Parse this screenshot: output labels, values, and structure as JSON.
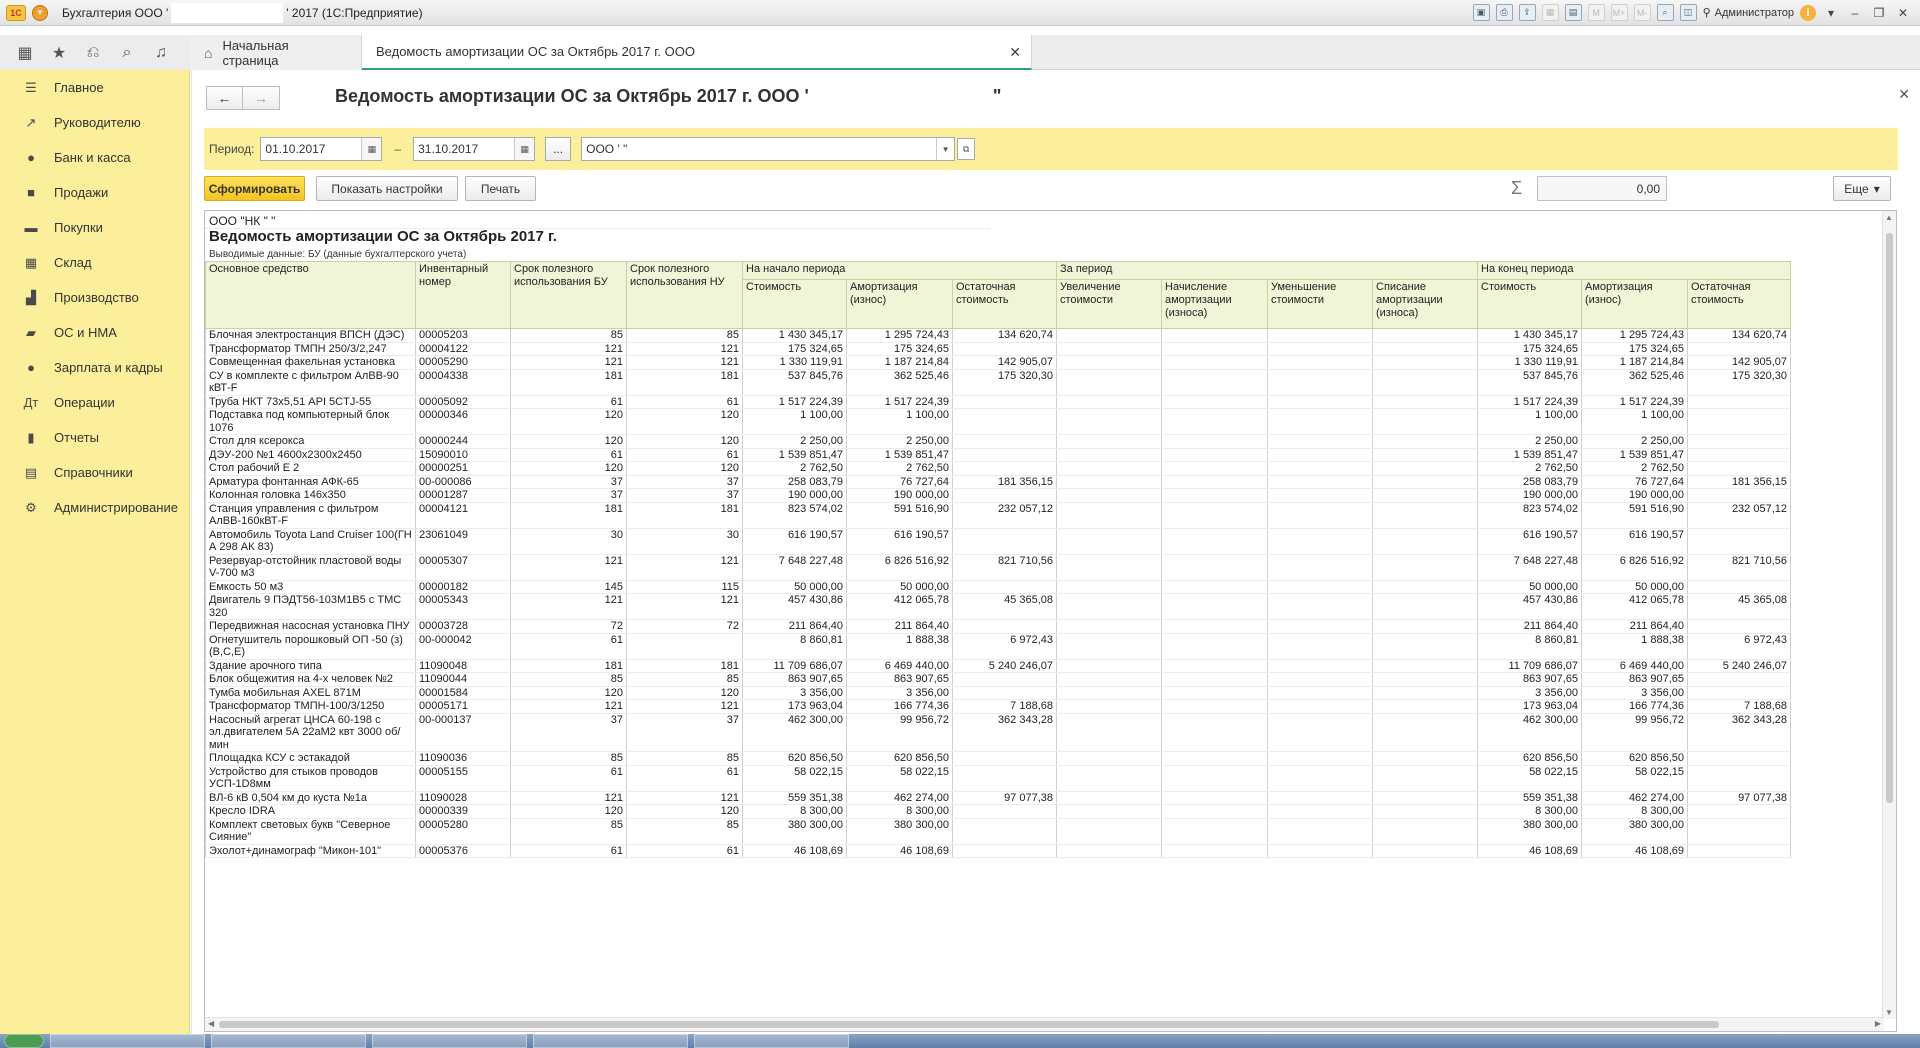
{
  "window": {
    "title_prefix": "Бухгалтерия ООО '",
    "title_suffix": "' 2017  (1С:Предприятие)",
    "user": "Администратор",
    "toolbar_icons": [
      "save-icon",
      "print-icon",
      "upload-icon",
      "calendar-icon",
      "calendar-grid-icon",
      "memory-m-icon",
      "memory-m-plus-icon",
      "memory-m-minus-icon",
      "zoom-icon",
      "panel-icon"
    ],
    "memory_labels": [
      "M",
      "M+",
      "M-"
    ]
  },
  "tabs": {
    "home": "Начальная страница",
    "active": "Ведомость амортизации ОС за Октябрь 2017 г. ООО"
  },
  "sidebar": {
    "items": [
      {
        "label": "Главное",
        "icon": "menu-icon",
        "glyph": "☰"
      },
      {
        "label": "Руководителю",
        "icon": "trend-icon",
        "glyph": "↗"
      },
      {
        "label": "Банк и касса",
        "icon": "coin-icon",
        "glyph": "●"
      },
      {
        "label": "Продажи",
        "icon": "bag-icon",
        "glyph": "■"
      },
      {
        "label": "Покупки",
        "icon": "cart-icon",
        "glyph": "▬"
      },
      {
        "label": "Склад",
        "icon": "warehouse-icon",
        "glyph": "▦"
      },
      {
        "label": "Производство",
        "icon": "factory-icon",
        "glyph": "▟"
      },
      {
        "label": "ОС и НМА",
        "icon": "truck-icon",
        "glyph": "▰"
      },
      {
        "label": "Зарплата и кадры",
        "icon": "person-icon",
        "glyph": "●"
      },
      {
        "label": "Операции",
        "icon": "operations-icon",
        "glyph": "Дт"
      },
      {
        "label": "Отчеты",
        "icon": "bar-chart-icon",
        "glyph": "▮"
      },
      {
        "label": "Справочники",
        "icon": "book-icon",
        "glyph": "▤"
      },
      {
        "label": "Администрирование",
        "icon": "gear-icon",
        "glyph": "⚙"
      }
    ]
  },
  "form": {
    "title_prefix": "Ведомость амортизации ОС за Октябрь 2017 г. ООО '",
    "title_suffix": "\"",
    "period_label": "Период:",
    "date_from": "01.10.2017",
    "date_to": "31.10.2017",
    "dots": "...",
    "organization": "ООО '                              \"",
    "buttons": {
      "generate": "Сформировать",
      "settings": "Показать настройки",
      "print": "Печать",
      "more": "Еще"
    },
    "sum_value": "0,00"
  },
  "report": {
    "org_line": "ООО \"НК \"                              \"",
    "title": "Ведомость амортизации ОС за Октябрь 2017 г.",
    "subtitle": "Выводимые данные:  БУ (данные бухгалтерского учета)",
    "header_groups": {
      "asset": "Основное средство",
      "inv": "Инвентарный номер",
      "term_bu": "Срок полезного использования БУ",
      "term_nu": "Срок полезного использования НУ",
      "start": "На начало периода",
      "period": "За период",
      "end": "На конец периода"
    },
    "sub_headers": {
      "start": [
        "Стоимость",
        "Амортизация (износ)",
        "Остаточная стоимость"
      ],
      "period": [
        "Увеличение стоимости",
        "Начисление амортизации (износа)",
        "Уменьшение стоимости",
        "Списание амортизации (износа)"
      ],
      "end": [
        "Стоимость",
        "Амортизация (износ)",
        "Остаточная стоимость"
      ]
    },
    "rows": [
      [
        "Блочная электростанция ВПСН (ДЭС)",
        "00005203",
        "85",
        "85",
        "1 430 345,17",
        "1 295 724,43",
        "134 620,74",
        "",
        "",
        "",
        "",
        "1 430 345,17",
        "1 295 724,43",
        "134 620,74"
      ],
      [
        "Трансформатор ТМПН 250/3/2,247",
        "00004122",
        "121",
        "121",
        "175 324,65",
        "175 324,65",
        "",
        "",
        "",
        "",
        "",
        "175 324,65",
        "175 324,65",
        ""
      ],
      [
        "Совмещенная факельная установка",
        "00005290",
        "121",
        "121",
        "1 330 119,91",
        "1 187 214,84",
        "142 905,07",
        "",
        "",
        "",
        "",
        "1 330 119,91",
        "1 187 214,84",
        "142 905,07"
      ],
      [
        "СУ в комплекте с фильтром АлВВ-90 кВТ-F",
        "00004338",
        "181",
        "181",
        "537 845,76",
        "362 525,46",
        "175 320,30",
        "",
        "",
        "",
        "",
        "537 845,76",
        "362 525,46",
        "175 320,30"
      ],
      [
        "Труба НКТ 73х5,51 API 5CTJ-55",
        "00005092",
        "61",
        "61",
        "1 517 224,39",
        "1 517 224,39",
        "",
        "",
        "",
        "",
        "",
        "1 517 224,39",
        "1 517 224,39",
        ""
      ],
      [
        "Подставка под компьютерный блок 1076",
        "00000346",
        "120",
        "120",
        "1 100,00",
        "1 100,00",
        "",
        "",
        "",
        "",
        "",
        "1 100,00",
        "1 100,00",
        ""
      ],
      [
        "Стол для ксерокса",
        "00000244",
        "120",
        "120",
        "2 250,00",
        "2 250,00",
        "",
        "",
        "",
        "",
        "",
        "2 250,00",
        "2 250,00",
        ""
      ],
      [
        "ДЭУ-200 №1 4600х2300х2450",
        "15090010",
        "61",
        "61",
        "1 539 851,47",
        "1 539 851,47",
        "",
        "",
        "",
        "",
        "",
        "1 539 851,47",
        "1 539 851,47",
        ""
      ],
      [
        "Стол рабочий Е 2",
        "00000251",
        "120",
        "120",
        "2 762,50",
        "2 762,50",
        "",
        "",
        "",
        "",
        "",
        "2 762,50",
        "2 762,50",
        ""
      ],
      [
        "Арматура фонтанная АФК-65",
        "00-000086",
        "37",
        "37",
        "258 083,79",
        "76 727,64",
        "181 356,15",
        "",
        "",
        "",
        "",
        "258 083,79",
        "76 727,64",
        "181 356,15"
      ],
      [
        "Колонная головка 146х350",
        "00001287",
        "37",
        "37",
        "190 000,00",
        "190 000,00",
        "",
        "",
        "",
        "",
        "",
        "190 000,00",
        "190 000,00",
        ""
      ],
      [
        "Станция управления с фильтром АлВВ-160кВТ-F",
        "00004121",
        "181",
        "181",
        "823 574,02",
        "591 516,90",
        "232 057,12",
        "",
        "",
        "",
        "",
        "823 574,02",
        "591 516,90",
        "232 057,12"
      ],
      [
        "Автомобиль Toyota Land Cruiser 100(ГН  А 298 АК 83)",
        "23061049",
        "30",
        "30",
        "616 190,57",
        "616 190,57",
        "",
        "",
        "",
        "",
        "",
        "616 190,57",
        "616 190,57",
        ""
      ],
      [
        "Резервуар-отстойник пластовой воды V-700 м3",
        "00005307",
        "121",
        "121",
        "7 648 227,48",
        "6 826 516,92",
        "821 710,56",
        "",
        "",
        "",
        "",
        "7 648 227,48",
        "6 826 516,92",
        "821 710,56"
      ],
      [
        "Емкость 50 м3",
        "00000182",
        "145",
        "115",
        "50 000,00",
        "50 000,00",
        "",
        "",
        "",
        "",
        "",
        "50 000,00",
        "50 000,00",
        ""
      ],
      [
        "Двигатель 9 ПЭДТ56-103М1В5 с ТМС 320",
        "00005343",
        "121",
        "121",
        "457 430,86",
        "412 065,78",
        "45 365,08",
        "",
        "",
        "",
        "",
        "457 430,86",
        "412 065,78",
        "45 365,08"
      ],
      [
        "Передвижная насосная установка ПНУ",
        "00003728",
        "72",
        "72",
        "211 864,40",
        "211 864,40",
        "",
        "",
        "",
        "",
        "",
        "211 864,40",
        "211 864,40",
        ""
      ],
      [
        "Огнетушитель  порошковый ОП -50 (з) (В,С,Е)",
        "00-000042",
        "61",
        "",
        "8 860,81",
        "1 888,38",
        "6 972,43",
        "",
        "",
        "",
        "",
        "8 860,81",
        "1 888,38",
        "6 972,43"
      ],
      [
        "Здание арочного типа",
        "11090048",
        "181",
        "181",
        "11 709 686,07",
        "6 469 440,00",
        "5 240 246,07",
        "",
        "",
        "",
        "",
        "11 709 686,07",
        "6 469 440,00",
        "5 240 246,07"
      ],
      [
        "Блок общежития на 4-х человек №2",
        "11090044",
        "85",
        "85",
        "863 907,65",
        "863 907,65",
        "",
        "",
        "",
        "",
        "",
        "863 907,65",
        "863 907,65",
        ""
      ],
      [
        "Тумба мобильная AXEL 871M",
        "00001584",
        "120",
        "120",
        "3 356,00",
        "3 356,00",
        "",
        "",
        "",
        "",
        "",
        "3 356,00",
        "3 356,00",
        ""
      ],
      [
        "Трансформатор ТМПН-100/3/1250",
        "00005171",
        "121",
        "121",
        "173 963,04",
        "166 774,36",
        "7 188,68",
        "",
        "",
        "",
        "",
        "173 963,04",
        "166 774,36",
        "7 188,68"
      ],
      [
        "Насосный агрегат ЦНСА 60-198 с эл.двигателем 5А  22аМ2 квт 3000 об/мин",
        "00-000137",
        "37",
        "37",
        "462 300,00",
        "99 956,72",
        "362 343,28",
        "",
        "",
        "",
        "",
        "462 300,00",
        "99 956,72",
        "362 343,28"
      ],
      [
        "Площадка КСУ с эстакадой",
        "11090036",
        "85",
        "85",
        "620 856,50",
        "620 856,50",
        "",
        "",
        "",
        "",
        "",
        "620 856,50",
        "620 856,50",
        ""
      ],
      [
        "Устройство для стыков проводов УСП-1D8мм",
        "00005155",
        "61",
        "61",
        "58 022,15",
        "58 022,15",
        "",
        "",
        "",
        "",
        "",
        "58 022,15",
        "58 022,15",
        ""
      ],
      [
        "ВЛ-6 кВ 0,504 км до куста №1а",
        "11090028",
        "121",
        "121",
        "559 351,38",
        "462 274,00",
        "97 077,38",
        "",
        "",
        "",
        "",
        "559 351,38",
        "462 274,00",
        "97 077,38"
      ],
      [
        "Кресло IDRA",
        "00000339",
        "120",
        "120",
        "8 300,00",
        "8 300,00",
        "",
        "",
        "",
        "",
        "",
        "8 300,00",
        "8 300,00",
        ""
      ],
      [
        "Комплект световых букв \"Северное Сияние\"",
        "00005280",
        "85",
        "85",
        "380 300,00",
        "380 300,00",
        "",
        "",
        "",
        "",
        "",
        "380 300,00",
        "380 300,00",
        ""
      ],
      [
        "Эхолот+динамограф \"Микон-101\"",
        "00005376",
        "61",
        "61",
        "46 108,69",
        "46 108,69",
        "",
        "",
        "",
        "",
        "",
        "46 108,69",
        "46 108,69",
        ""
      ]
    ]
  }
}
